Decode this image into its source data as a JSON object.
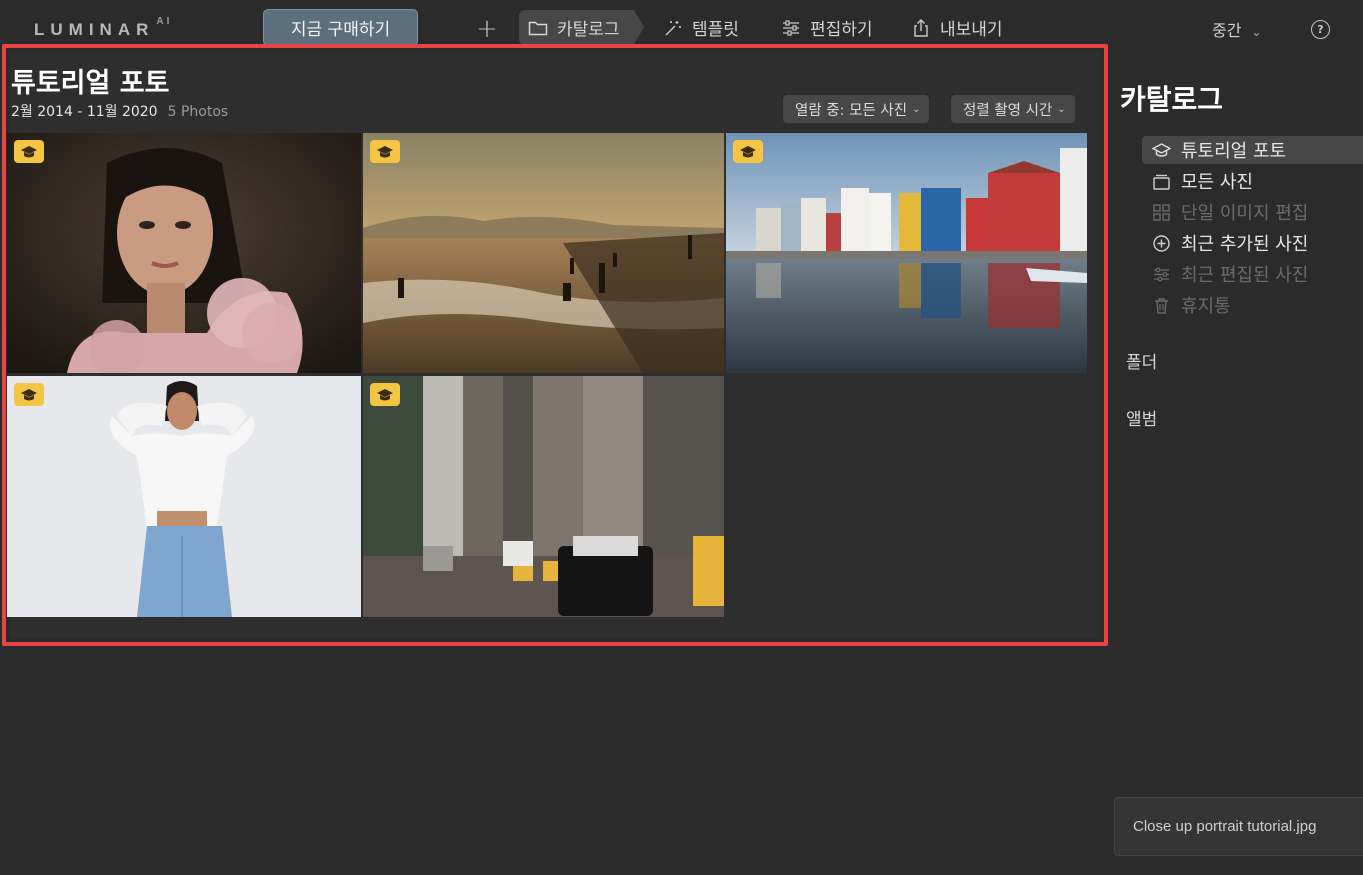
{
  "app": {
    "logo_text": "LUMINAR",
    "logo_sup": "AI",
    "buy_label": "지금 구매하기",
    "add_label": "+",
    "nav": {
      "catalog": "카탈로그",
      "templates": "템플릿",
      "edit": "편집하기",
      "export": "내보내기"
    },
    "zoom_label": "중간",
    "help_label": "?"
  },
  "main": {
    "album_title": "튜토리얼 포토",
    "date_range": "2월 2014 - 11월 2020",
    "photo_count": "5 Photos",
    "view_filter": "열람 중: 모든 사진",
    "sort_filter": "정렬 촬영 시간"
  },
  "sidebar": {
    "title": "카탈로그",
    "items": [
      {
        "label": "튜토리얼 포토",
        "icon": "graduation-cap-icon"
      },
      {
        "label": "모든 사진",
        "icon": "photo-stack-icon"
      },
      {
        "label": "단일 이미지 편집",
        "icon": "grid-icon"
      },
      {
        "label": "최근 추가된 사진",
        "icon": "plus-circle-icon"
      },
      {
        "label": "최근 편집된 사진",
        "icon": "sliders-icon"
      },
      {
        "label": "휴지통",
        "icon": "trash-icon"
      }
    ],
    "folders": "폴더",
    "albums": "앨범"
  },
  "toast": {
    "text": "Close up portrait tutorial.jpg"
  },
  "colors": {
    "accent_selection": "#4ac7ef",
    "badge": "#f4c543",
    "highlight_frame": "#e94545"
  }
}
